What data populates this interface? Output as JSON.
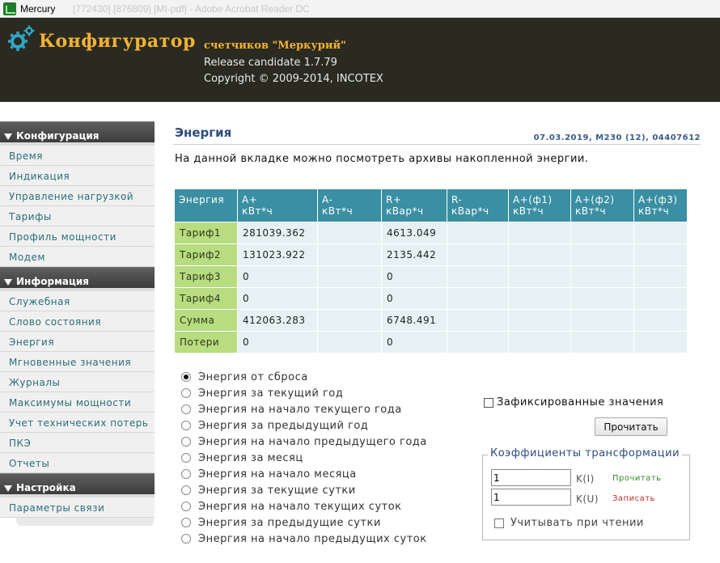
{
  "window": {
    "title": "Mercury",
    "title_faded": "[772430] [876809] [MI-pdf] - Adobe Acrobat Reader DC"
  },
  "header": {
    "brand": "Конфигуратор",
    "subtitle": "счетчиков \"Меркурий\"",
    "release": "Release candidate 1.7.79",
    "copyright": "Copyright © 2009-2014, INCOTEX"
  },
  "sidebar": {
    "sections": [
      {
        "title": "Конфигурация",
        "items": [
          "Время",
          "Индикация",
          "Управление нагрузкой",
          "Тарифы",
          "Профиль мощности",
          "Модем"
        ]
      },
      {
        "title": "Информация",
        "items": [
          "Служебная",
          "Слово состояния",
          "Энергия",
          "Мгновенные значения",
          "Журналы",
          "Максимумы мощности",
          "Учет технических потерь",
          "ПКЭ",
          "Отчеты"
        ]
      },
      {
        "title": "Настройка",
        "items": [
          "Параметры связи"
        ]
      }
    ]
  },
  "main": {
    "title": "Энергия",
    "device_info": "07.03.2019, M230 (12), 04407612",
    "description": "На данной вкладке можно посмотреть архивы накопленной энергии."
  },
  "table": {
    "headers": [
      [
        "Энергия",
        ""
      ],
      [
        "A+",
        "кВт*ч"
      ],
      [
        "A-",
        "кВт*ч"
      ],
      [
        "R+",
        "кВар*ч"
      ],
      [
        "R-",
        "кВар*ч"
      ],
      [
        "A+(ф1)",
        "кВт*ч"
      ],
      [
        "A+(ф2)",
        "кВт*ч"
      ],
      [
        "A+(ф3)",
        "кВт*ч"
      ]
    ],
    "rows": [
      [
        "Тариф1",
        "281039.362",
        "",
        "4613.049",
        "",
        "",
        "",
        ""
      ],
      [
        "Тариф2",
        "131023.922",
        "",
        "2135.442",
        "",
        "",
        "",
        ""
      ],
      [
        "Тариф3",
        "0",
        "",
        "0",
        "",
        "",
        "",
        ""
      ],
      [
        "Тариф4",
        "0",
        "",
        "0",
        "",
        "",
        "",
        ""
      ],
      [
        "Сумма",
        "412063.283",
        "",
        "6748.491",
        "",
        "",
        "",
        ""
      ],
      [
        "Потери",
        "0",
        "",
        "0",
        "",
        "",
        "",
        ""
      ]
    ]
  },
  "radios": {
    "selected": 0,
    "options": [
      "Энергия от сброса",
      "Энергия за текущий год",
      "Энергия на начало текущего года",
      "Энергия за предыдущий год",
      "Энергия на начало предыдущего года",
      "Энергия за месяц",
      "Энергия на начало месяца",
      "Энергия за текущие сутки",
      "Энергия на начало текущих суток",
      "Энергия за предыдущие сутки",
      "Энергия на начало предыдущих суток"
    ]
  },
  "controls": {
    "fixed_values_label": "Зафиксированные значения",
    "fixed_values_checked": false,
    "read_button": "Прочитать"
  },
  "transform": {
    "legend": "Коэффициенты трансформации",
    "ki_value": "1",
    "ki_label": "K(I)",
    "ku_value": "1",
    "ku_label": "K(U)",
    "read_link": "Прочитать",
    "write_link": "Записать",
    "consider_label": "Учитывать при чтении",
    "consider_checked": false
  },
  "colors": {
    "header_bg": "#2a2a20",
    "brand": "#f2b233",
    "gear": "#2fa6c4",
    "table_header": "#3a8fa2",
    "row_label": "#b8dc80",
    "cell": "#e6f1f3"
  }
}
